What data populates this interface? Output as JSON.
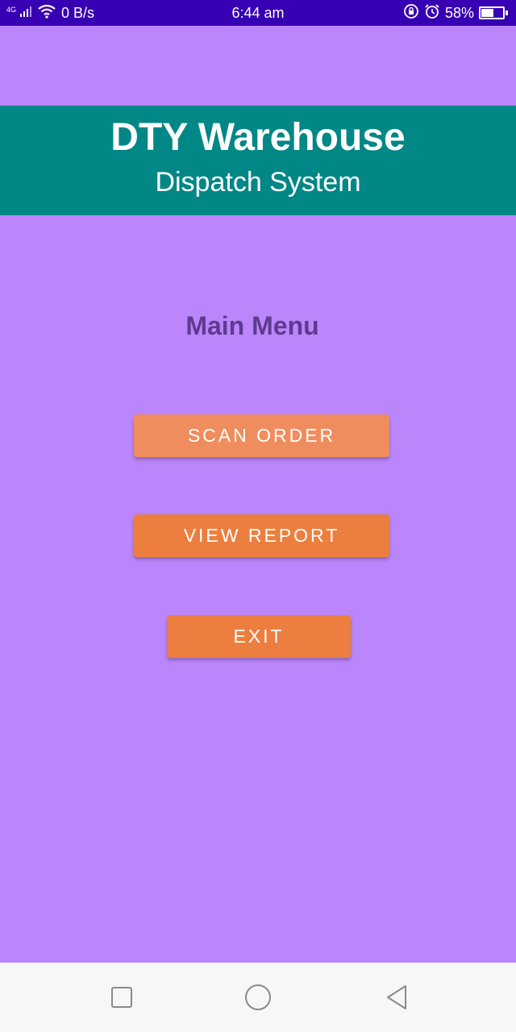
{
  "status_bar": {
    "network": "4G",
    "data_speed": "0 B/s",
    "time": "6:44 am",
    "battery_percent": "58%",
    "battery_level": 0.58
  },
  "header": {
    "title": "DTY Warehouse",
    "subtitle": "Dispatch System"
  },
  "main": {
    "menu_title": "Main Menu",
    "buttons": [
      {
        "label": "SCAN ORDER"
      },
      {
        "label": "VIEW REPORT"
      },
      {
        "label": "EXIT"
      }
    ]
  },
  "nav_bar": {
    "icons": [
      "recent-apps-icon",
      "home-icon",
      "back-icon"
    ]
  },
  "colors": {
    "status_bar": "#3700b3",
    "background": "#bb86fc",
    "header": "#018786",
    "button_accent": "#ec7f3f",
    "button_highlight": "#ef8d5e",
    "menu_title": "#5f3a8f"
  }
}
